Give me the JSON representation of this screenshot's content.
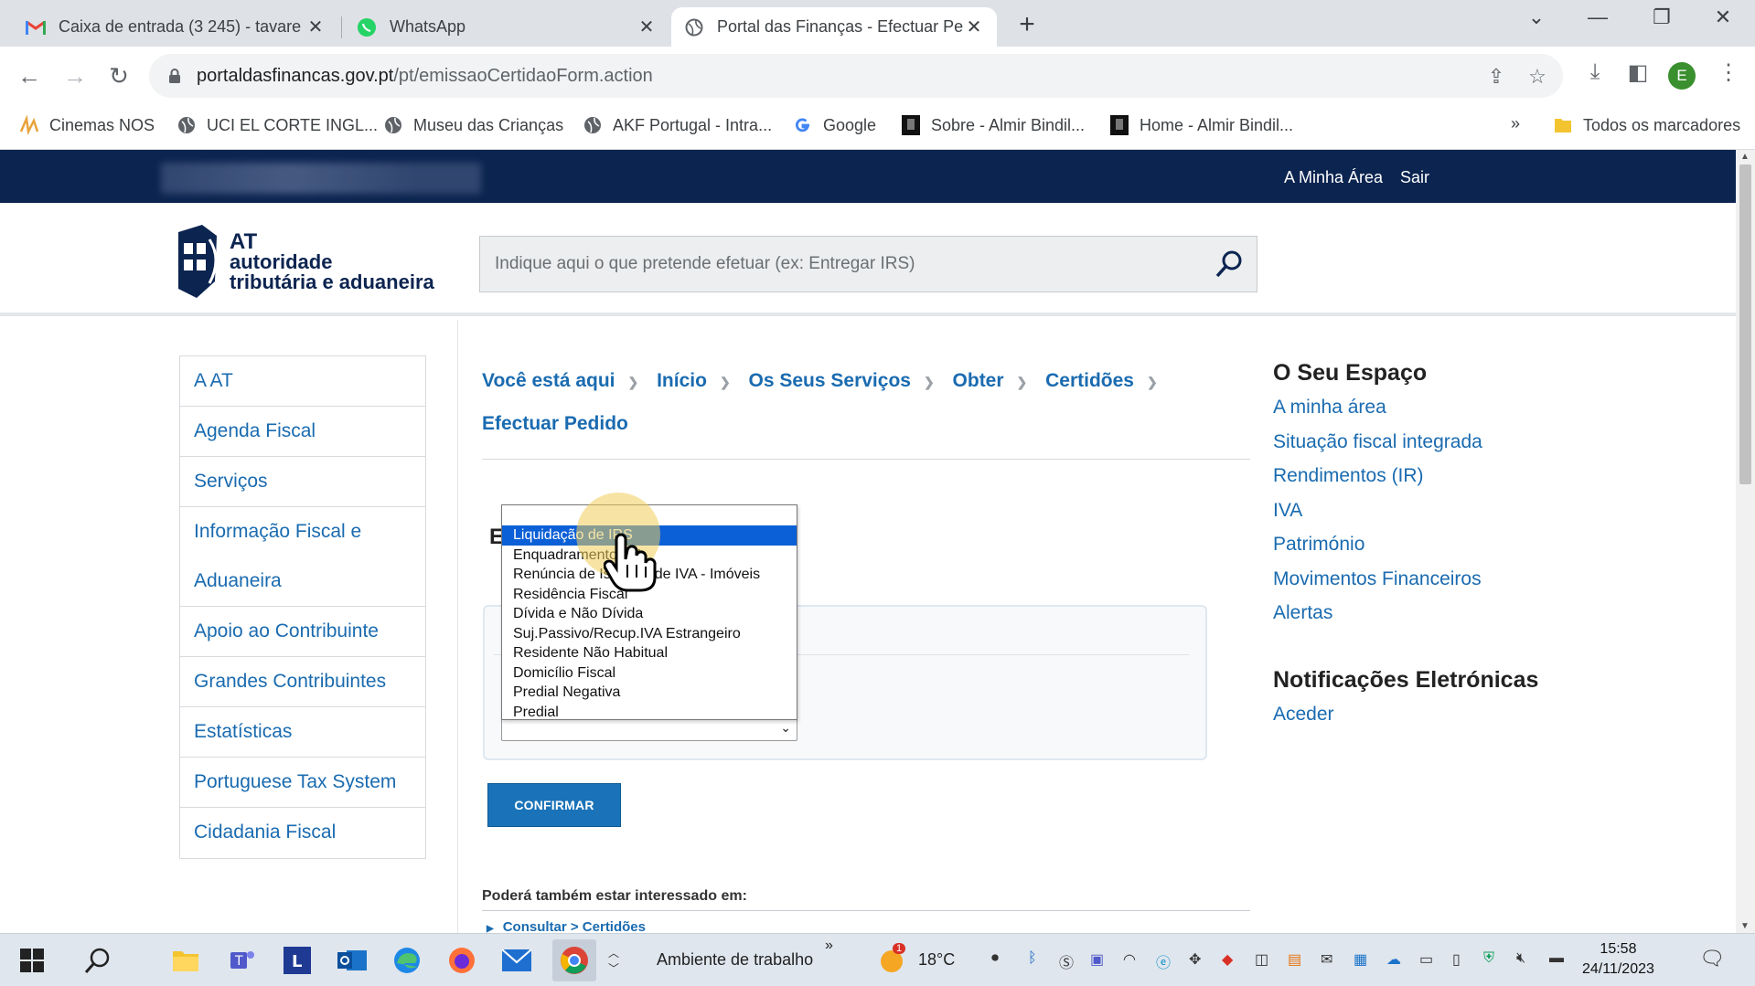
{
  "browser": {
    "tabs": [
      {
        "title": "Caixa de entrada (3 245) - tavare",
        "icon": "gmail-icon"
      },
      {
        "title": "WhatsApp",
        "icon": "whatsapp-icon"
      },
      {
        "title": "Portal das Finanças - Efectuar Pe",
        "icon": "globe-icon"
      }
    ],
    "url_domain": "portaldasfinancas.gov.pt",
    "url_path": "/pt/emissaoCertidaoForm.action",
    "profile_initial": "E",
    "bookmarks": [
      {
        "label": "Cinemas NOS"
      },
      {
        "label": "UCI EL CORTE INGL..."
      },
      {
        "label": "Museu das Crianças"
      },
      {
        "label": "AKF Portugal - Intra..."
      },
      {
        "label": "Google"
      },
      {
        "label": "Sobre - Almir Bindil..."
      },
      {
        "label": "Home - Almir Bindil..."
      }
    ],
    "bookmarks_overflow": "»",
    "all_bookmarks": "Todos os marcadores"
  },
  "site": {
    "topbar": {
      "my_area": "A Minha Área",
      "logout": "Sair"
    },
    "logo": {
      "line1": "AT",
      "line2": "autoridade",
      "line3": "tributária e aduaneira"
    },
    "search_placeholder": "Indique aqui o que pretende efetuar (ex: Entregar IRS)",
    "left_menu": [
      "A AT",
      "Agenda Fiscal",
      "Serviços",
      "Informação Fiscal e Aduaneira",
      "Apoio ao Contribuinte",
      "Grandes Contribuintes",
      "Estatísticas",
      "Portuguese Tax System",
      "Cidadania Fiscal"
    ],
    "breadcrumb": [
      "Você está aqui",
      "Início",
      "Os Seus Serviços",
      "Obter",
      "Certidões",
      "Efectuar Pedido"
    ],
    "form_title_initial": "E",
    "dropdown_options": [
      "Liquidação de IRS",
      "Enquadramento IVA",
      "Renúncia de Isenção de IVA - Imóveis",
      "Residência Fiscal",
      "Dívida e Não Dívida",
      "Suj.Passivo/Recup.IVA Estrangeiro",
      "Residente Não Habitual",
      "Domicílio Fiscal",
      "Predial Negativa",
      "Predial"
    ],
    "dropdown_selected_index": 0,
    "confirm_label": "CONFIRMAR",
    "interest_title": "Poderá também estar interessado em:",
    "interest_link": "Consultar > Certidões",
    "right": {
      "space_title": "O Seu Espaço",
      "space_links": [
        "A minha área",
        "Situação fiscal integrada",
        "Rendimentos (IR)",
        "IVA",
        "Património",
        "Movimentos Financeiros",
        "Alertas"
      ],
      "notif_title": "Notificações Eletrónicas",
      "notif_link": "Aceder"
    },
    "colors": {
      "navy": "#0c2450",
      "link": "#1a6bb0",
      "button": "#1a73b8",
      "selected": "#0b5fd7"
    }
  },
  "taskbar": {
    "workspace_label": "Ambiente de trabalho",
    "overflow": "»",
    "weather_temp": "18°C",
    "weather_badge": "1",
    "time": "15:58",
    "date": "24/11/2023"
  }
}
